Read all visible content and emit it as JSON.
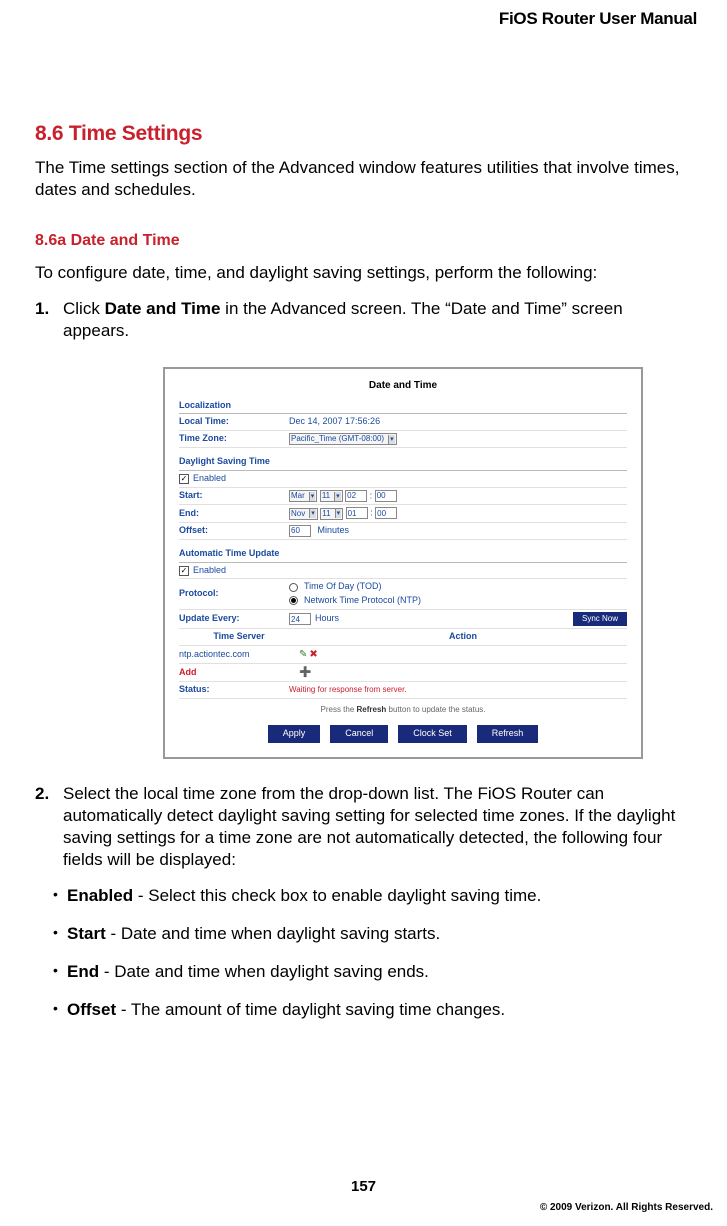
{
  "header": {
    "title": "FiOS Router User Manual"
  },
  "section": {
    "number_title": "8.6  Time Settings",
    "intro": "The Time settings section of the Advanced window features utilities that involve times, dates and schedules.",
    "sub_number_title": "8.6a Date and Time",
    "config_line": "To configure date, time, and daylight saving settings, perform the following:"
  },
  "steps": [
    {
      "n": "1.",
      "pre": "Click ",
      "bold": "Date and Time",
      "post": " in the Advanced screen. The “Date and Time” screen appears."
    },
    {
      "n": "2.",
      "text": "Select the local time zone from the drop-down list. The FiOS Router can automatically detect daylight saving setting for selected time zones. If the daylight saving settings for a time zone are not automatically detected, the following four fields will be displayed:"
    }
  ],
  "bullets": [
    {
      "bold": "Enabled",
      "rest": " - Select this check box to enable daylight saving time."
    },
    {
      "bold": "Start",
      "rest": " - Date and time when daylight saving starts."
    },
    {
      "bold": "End",
      "rest": " - Date and time when daylight saving ends."
    },
    {
      "bold": "Offset",
      "rest": " - The amount of time daylight saving time changes."
    }
  ],
  "screenshot": {
    "title": "Date and Time",
    "localization_label": "Localization",
    "local_time_label": "Local Time:",
    "local_time_value": "Dec 14, 2007 17:56:26",
    "time_zone_label": "Time Zone:",
    "time_zone_value": "Pacific_Time (GMT-08:00)",
    "dst_label": "Daylight Saving Time",
    "enabled_label": "Enabled",
    "start_label": "Start:",
    "start_month": "Mar",
    "start_day": "11",
    "start_hh": "02",
    "start_mm": "00",
    "end_label": "End:",
    "end_month": "Nov",
    "end_day": "11",
    "end_hh": "01",
    "end_mm": "00",
    "offset_label": "Offset:",
    "offset_value": "60",
    "offset_unit": "Minutes",
    "atu_label": "Automatic Time Update",
    "protocol_label": "Protocol:",
    "protocol_tod": "Time Of Day (TOD)",
    "protocol_ntp": "Network Time Protocol (NTP)",
    "update_every_label": "Update Every:",
    "update_every_value": "24",
    "update_every_unit": "Hours",
    "sync_now": "Sync Now",
    "time_server_label": "Time Server",
    "action_label": "Action",
    "server1": "ntp.actiontec.com",
    "add_label": "Add",
    "status_label": "Status:",
    "status_value": "Waiting for response from server.",
    "refresh_note": "Press the Refresh button to update the status.",
    "refresh_bold": "Refresh",
    "buttons": {
      "apply": "Apply",
      "cancel": "Cancel",
      "clock_set": "Clock Set",
      "refresh": "Refresh"
    }
  },
  "footer": {
    "page": "157",
    "copyright": "© 2009 Verizon. All Rights Reserved."
  }
}
